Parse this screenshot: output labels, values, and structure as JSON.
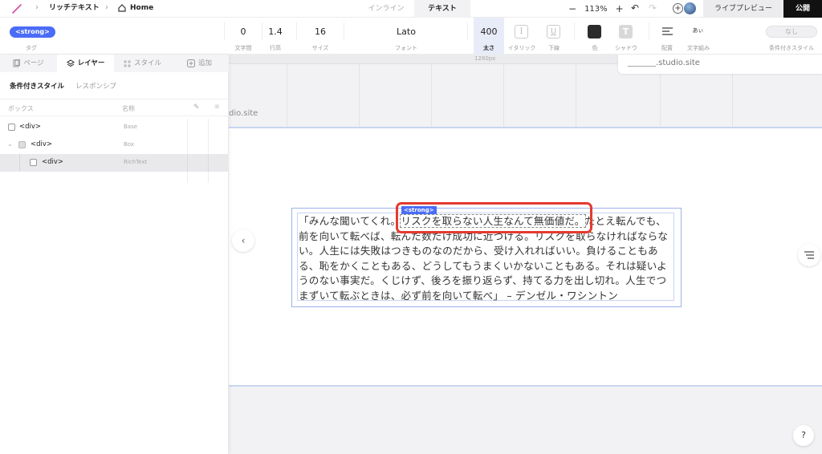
{
  "topbar": {
    "breadcrumb": [
      "リッチテキスト",
      "Home"
    ],
    "mode_tabs": [
      "インライン",
      "テキスト"
    ],
    "active_mode": "テキスト",
    "zoom_level": "113%",
    "zoom_minus": "−",
    "zoom_plus": "+",
    "add_user": "+",
    "preview_label": "ライブプレビュー",
    "publish_label": "公開"
  },
  "toolbar": {
    "tag_value": "<strong>",
    "tag_caption": "タグ",
    "letter_spacing": {
      "value": "0",
      "caption": "文字間"
    },
    "line_height": {
      "value": "1.4",
      "caption": "行高"
    },
    "font_size": {
      "value": "16",
      "caption": "サイズ"
    },
    "font_family": {
      "value": "Lato",
      "caption": "フォント"
    },
    "font_weight": {
      "value": "400",
      "caption": "太さ"
    },
    "italic": {
      "glyph": "I",
      "caption": "イタリック"
    },
    "underline": {
      "glyph": "U",
      "caption": "下線"
    },
    "color": {
      "caption": "色",
      "swatch": "#2b2b2b"
    },
    "shadow": {
      "glyph": "T",
      "caption": "シャドウ"
    },
    "align": {
      "caption": "配置"
    },
    "wrap": {
      "glyph": "あぃ",
      "caption": "文字組み"
    },
    "conditional": {
      "value": "なし",
      "caption": "条件付きスタイル"
    }
  },
  "panel": {
    "tabs": [
      {
        "label": "ページ",
        "icon": "page-icon"
      },
      {
        "label": "レイヤー",
        "icon": "layers-icon"
      },
      {
        "label": "スタイル",
        "icon": "style-icon"
      },
      {
        "label": "追加",
        "icon": "add-icon"
      }
    ],
    "active_tab": "レイヤー",
    "subtabs": [
      "条件付きスタイル",
      "レスポンシブ"
    ],
    "columns": {
      "box": "ボックス",
      "name": "名称"
    },
    "rows": [
      {
        "tag": "<div>",
        "label": "Base"
      },
      {
        "tag": "<div>",
        "label": "Box"
      },
      {
        "tag": "<div>",
        "label": "RichText"
      }
    ]
  },
  "canvas": {
    "ruler_label": "1280px",
    "site_hint": "dio.site",
    "url_popup": "_______.studio.site",
    "strong_tag_label": "<strong>",
    "text_before": "「みんな聞いてくれ。",
    "text_strong": "リスクを取らない人生なんて無価値だ。",
    "text_after": "たとえ転んでも、前を向いて転べば、転んだ数だけ成功に近づける。リスクを取らなければならない。人生には失敗はつきものなのだから、受け入れればいい。負けることもある、恥をかくこともある、どうしてもうまくいかないこともある。それは疑いようのない事実だ。くじけず、後ろを振り返らず、持てる力を出し切れ。人生でつまずいて転ぶときは、必ず前を向いて転べ」 – デンゼル・ワシントン",
    "nav_left": "‹",
    "help": "?"
  },
  "colors": {
    "accent": "#4a6cf7",
    "highlight": "#e43a2f",
    "publish_bg": "#111111"
  }
}
